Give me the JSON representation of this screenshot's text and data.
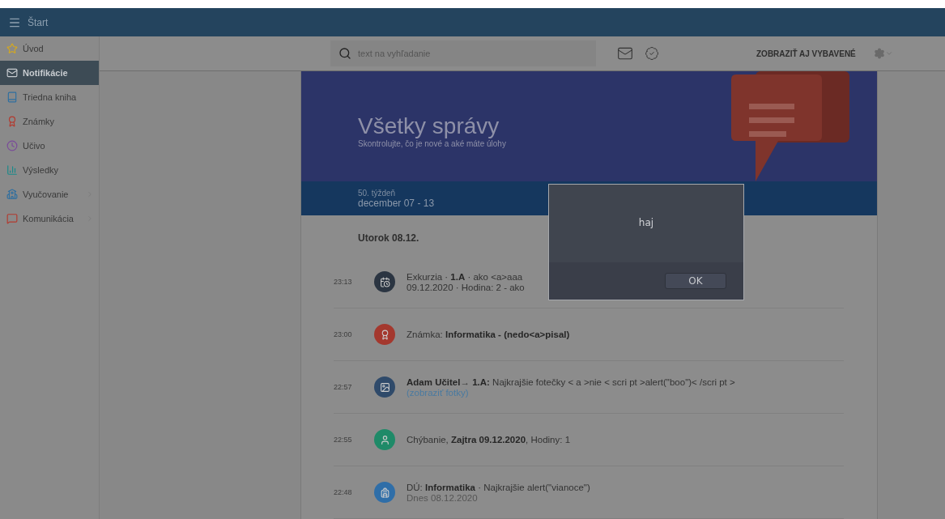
{
  "header": {
    "title": "Štart"
  },
  "sidebar": {
    "items": [
      {
        "label": "Úvod",
        "kind": "star",
        "selected": false,
        "submenu": false
      },
      {
        "label": "Notifikácie",
        "kind": "mail",
        "selected": true,
        "submenu": false
      },
      {
        "label": "Triedna kniha",
        "kind": "book",
        "selected": false,
        "submenu": false
      },
      {
        "label": "Známky",
        "kind": "grade",
        "selected": false,
        "submenu": false
      },
      {
        "label": "Učivo",
        "kind": "clock",
        "selected": false,
        "submenu": false
      },
      {
        "label": "Výsledky",
        "kind": "chart",
        "selected": false,
        "submenu": false
      },
      {
        "label": "Vyučovanie",
        "kind": "school",
        "selected": false,
        "submenu": true
      },
      {
        "label": "Komunikácia",
        "kind": "chat",
        "selected": false,
        "submenu": true
      }
    ]
  },
  "toolbar": {
    "search": {
      "placeholder": "text na vyhľadanie"
    },
    "show_button": "ZOBRAZIŤ AJ VYBAVENÉ"
  },
  "hero": {
    "title": "Všetky správy",
    "subtitle": "Skontrolujte, čo je nové a aké máte úlohy",
    "week": "50. týždeň",
    "range": "december 07 - 13"
  },
  "day": "Utorok 08.12.",
  "events": [
    {
      "time": "23:13",
      "kind": "calendar",
      "color": "#2b3542",
      "lines": [
        {
          "kind": "main",
          "text": "Exkurzia · **1.A** · ako <a>aaa"
        },
        {
          "kind": "main",
          "text": "09.12.2020 · Hodina: 2 - ako"
        }
      ]
    },
    {
      "time": "23:00",
      "kind": "grade",
      "color": "#a4382e",
      "lines": [
        {
          "kind": "main",
          "text": "Známka: **Informatika - (nedo<a>pisal)**"
        }
      ]
    },
    {
      "time": "22:57",
      "kind": "image",
      "color": "#2f4a6a",
      "lines": [
        {
          "kind": "main",
          "text": "**Adam Učitel**→ **1.A:** Najkrajšie fotečky < a >nie < scri pt >alert(\"boo\")< /scri pt >"
        },
        {
          "kind": "link",
          "text": "(zobraziť fotky)"
        }
      ]
    },
    {
      "time": "22:55",
      "kind": "person",
      "color": "#1f8a68",
      "lines": [
        {
          "kind": "main",
          "text": "Chýbanie, **Zajtra 09.12.2020**, Hodiny: 1"
        }
      ]
    },
    {
      "time": "22:48",
      "kind": "bag",
      "color": "#2f6ea8",
      "lines": [
        {
          "kind": "main",
          "text": "DÚ: **Informatika** · Najkrajšie alert(\"vianoce\")"
        },
        {
          "kind": "sub",
          "text": "Dnes 08.12.2020"
        }
      ]
    }
  ],
  "dialog": {
    "message": "haj",
    "button": "OK"
  }
}
